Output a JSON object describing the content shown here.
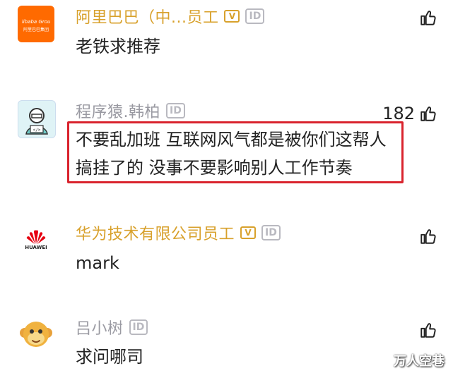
{
  "comments": [
    {
      "name": "阿里巴巴（中...员工",
      "name_color": "#d8a12c",
      "verified_badge": "V",
      "id_badge": "ID",
      "avatar_icon": "alibaba-group-logo",
      "avatar_text": "Alibaba Group",
      "avatar_subtext": "阿里巴巴集团",
      "text_lines": [
        "老铁求推荐"
      ],
      "like_count": ""
    },
    {
      "name": "程序猿.韩柏",
      "name_color": "#9a9aa2",
      "id_badge": "ID",
      "avatar_icon": "programmer-avatar",
      "text_lines": [
        "不要乱加班 互联网风气都是被你们这帮人",
        "搞挂了的 没事不要影响别人工作节奏"
      ],
      "like_count": "182"
    },
    {
      "name": "华为技术有限公司员工",
      "name_color": "#d8a12c",
      "verified_badge": "V",
      "id_badge": "ID",
      "avatar_icon": "huawei-logo",
      "avatar_text": "HUAWEI",
      "text_lines": [
        "mark"
      ],
      "like_count": ""
    },
    {
      "name": "吕小树",
      "name_color": "#9a9aa2",
      "id_badge": "ID",
      "avatar_icon": "monkey-avatar",
      "text_lines": [
        "求问哪司"
      ],
      "like_count": ""
    }
  ],
  "watermark": "万人空巷",
  "colors": {
    "highlight": "#d9232d",
    "alibaba_orange": "#ff6a00",
    "huawei_red": "#e60012"
  }
}
